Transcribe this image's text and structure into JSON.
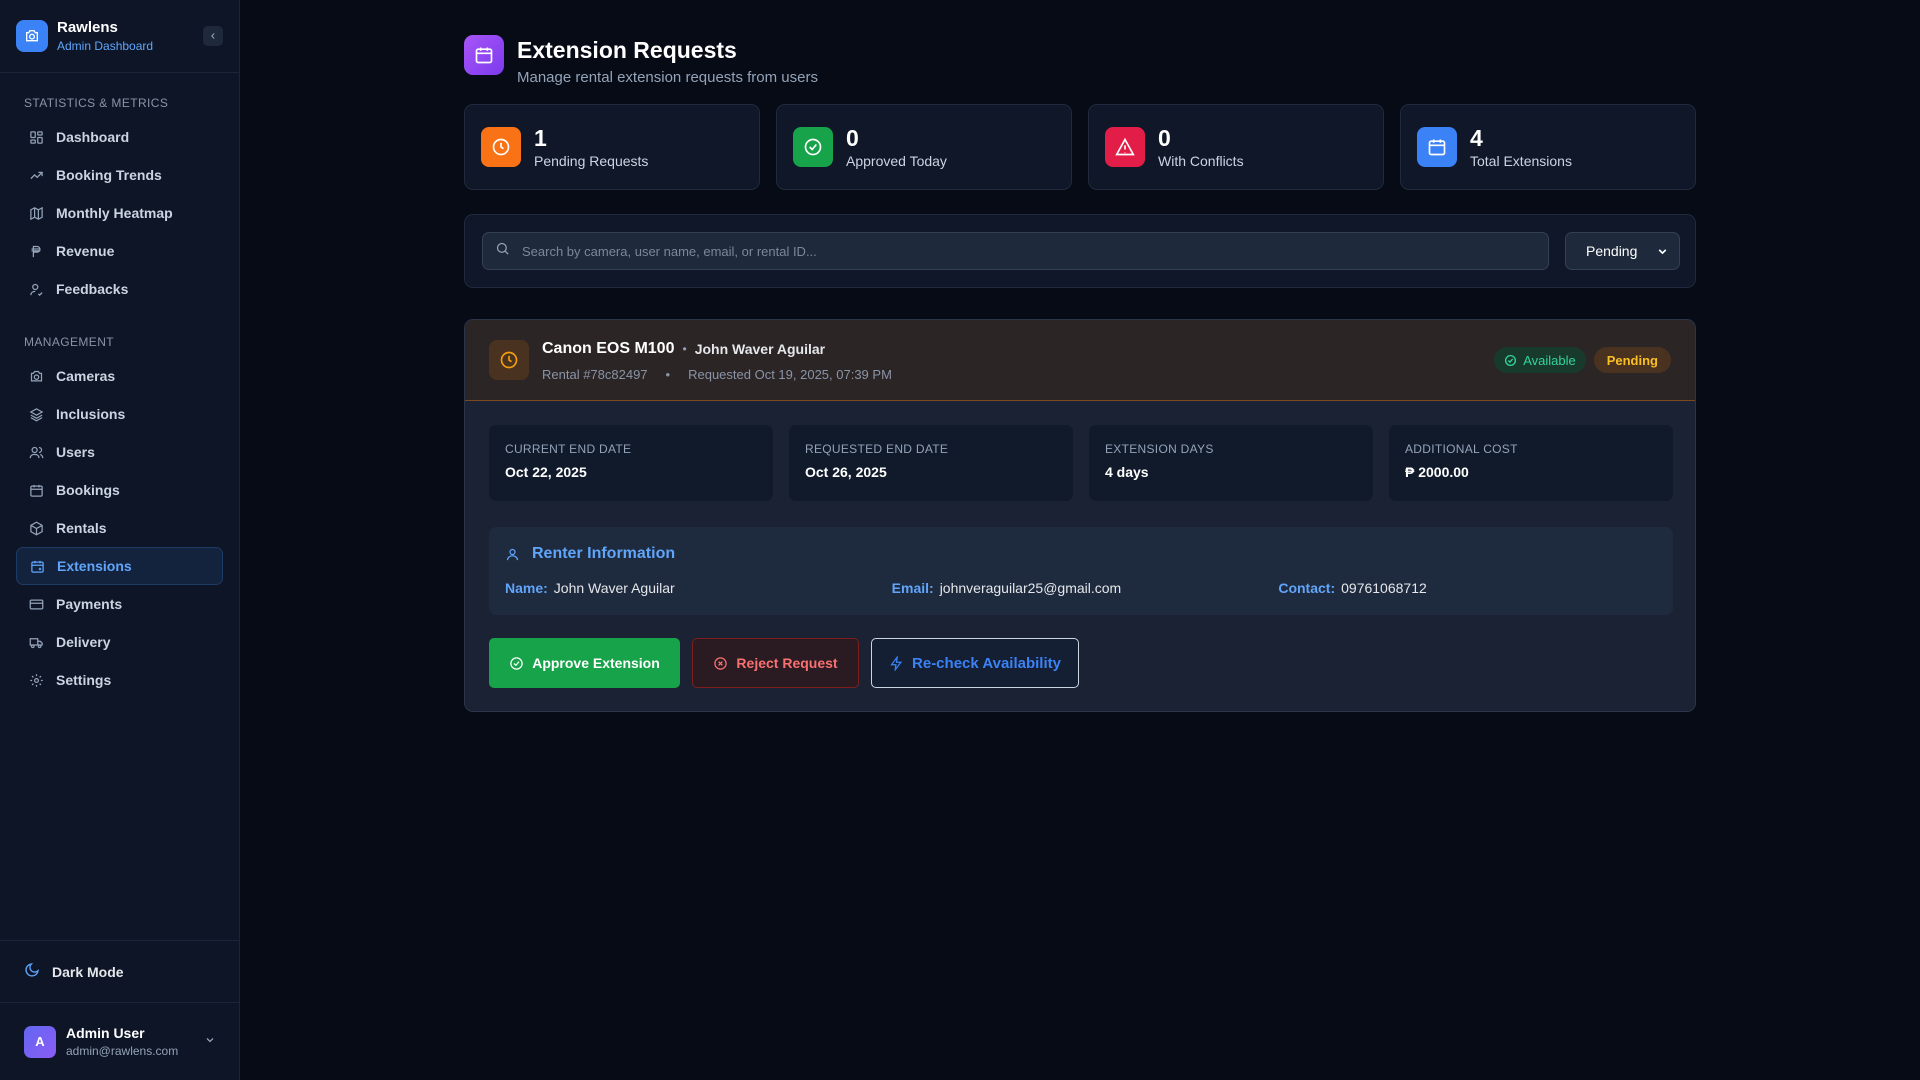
{
  "brand": {
    "name": "Rawlens",
    "subtitle": "Admin Dashboard"
  },
  "sidebar": {
    "sections": [
      {
        "heading": "STATISTICS & METRICS",
        "items": [
          {
            "label": "Dashboard",
            "icon": "dashboard-icon"
          },
          {
            "label": "Booking Trends",
            "icon": "trending-up-icon"
          },
          {
            "label": "Monthly Heatmap",
            "icon": "map-icon"
          },
          {
            "label": "Revenue",
            "icon": "peso-icon"
          },
          {
            "label": "Feedbacks",
            "icon": "user-feedback-icon"
          }
        ]
      },
      {
        "heading": "MANAGEMENT",
        "items": [
          {
            "label": "Cameras",
            "icon": "camera-icon"
          },
          {
            "label": "Inclusions",
            "icon": "layers-icon"
          },
          {
            "label": "Users",
            "icon": "users-icon"
          },
          {
            "label": "Bookings",
            "icon": "calendar-icon"
          },
          {
            "label": "Rentals",
            "icon": "package-icon"
          },
          {
            "label": "Extensions",
            "icon": "calendar-extension-icon",
            "active": true
          },
          {
            "label": "Payments",
            "icon": "credit-card-icon"
          },
          {
            "label": "Delivery",
            "icon": "truck-icon"
          },
          {
            "label": "Settings",
            "icon": "gear-icon"
          }
        ]
      }
    ],
    "dark_mode_label": "Dark Mode",
    "user": {
      "initial": "A",
      "name": "Admin User",
      "email": "admin@rawlens.com"
    }
  },
  "page": {
    "title": "Extension Requests",
    "subtitle": "Manage rental extension requests from users"
  },
  "stats": [
    {
      "value": "1",
      "label": "Pending Requests",
      "color": "#f97316"
    },
    {
      "value": "0",
      "label": "Approved Today",
      "color": "#16a34a"
    },
    {
      "value": "0",
      "label": "With Conflicts",
      "color": "#e11d48"
    },
    {
      "value": "4",
      "label": "Total Extensions",
      "color": "#3b82f6"
    }
  ],
  "filters": {
    "search_placeholder": "Search by camera, user name, email, or rental ID...",
    "status_value": "Pending"
  },
  "request": {
    "camera": "Canon EOS M100",
    "user": "John Waver Aguilar",
    "rental_id": "Rental #78c82497",
    "requested": "Requested Oct 19, 2025, 07:39 PM",
    "availability_badge": "Available",
    "status_badge": "Pending",
    "details": [
      {
        "label": "CURRENT END DATE",
        "value": "Oct 22, 2025"
      },
      {
        "label": "REQUESTED END DATE",
        "value": "Oct 26, 2025"
      },
      {
        "label": "EXTENSION DAYS",
        "value": "4 days"
      },
      {
        "label": "ADDITIONAL COST",
        "value": "₱ 2000.00"
      }
    ],
    "renter": {
      "title": "Renter Information",
      "name_label": "Name:",
      "name": "John Waver Aguilar",
      "email_label": "Email:",
      "email": "johnveraguilar25@gmail.com",
      "contact_label": "Contact:",
      "contact": "09761068712"
    },
    "actions": {
      "approve": "Approve Extension",
      "reject": "Reject Request",
      "recheck": "Re-check Availability"
    }
  }
}
